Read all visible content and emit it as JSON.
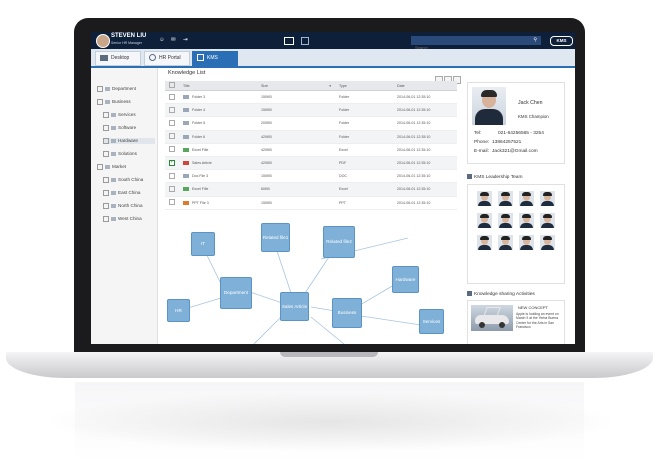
{
  "user": {
    "name": "STEVEN LIU",
    "role": "Senior HR Manager"
  },
  "search": {
    "placeholder": "Search"
  },
  "brand": {
    "label": "KMS"
  },
  "tabs": [
    {
      "label": "Desktop",
      "active": false
    },
    {
      "label": "HR Portal",
      "active": false
    },
    {
      "label": "KMS",
      "active": true
    }
  ],
  "sidebar": {
    "items": [
      {
        "label": "Department",
        "level": 0
      },
      {
        "label": "Business",
        "level": 0
      },
      {
        "label": "Services",
        "level": 1
      },
      {
        "label": "Software",
        "level": 1
      },
      {
        "label": "Hardware",
        "level": 1,
        "selected": true
      },
      {
        "label": "Solutions",
        "level": 1
      },
      {
        "label": "Market",
        "level": 0
      },
      {
        "label": "South China",
        "level": 1
      },
      {
        "label": "East China",
        "level": 1
      },
      {
        "label": "North China",
        "level": 1
      },
      {
        "label": "West China",
        "level": 1
      }
    ]
  },
  "knowledge_list": {
    "title": "Knowledge List",
    "columns": [
      "Title",
      "Size",
      "Type",
      "Date"
    ],
    "rows": [
      {
        "title": "Folder 3",
        "size": "150KB",
        "type": "Folder",
        "date": "2014-06-01 12:35:10",
        "icon": "folder",
        "checked": false
      },
      {
        "title": "Folder 4",
        "size": "150KB",
        "type": "Folder",
        "date": "2014-06-01 12:35:10",
        "icon": "folder",
        "checked": false
      },
      {
        "title": "Folder 5",
        "size": "200KB",
        "type": "Folder",
        "date": "2014-06-01 12:35:10",
        "icon": "folder",
        "checked": false
      },
      {
        "title": "Folder 6",
        "size": "420KB",
        "type": "Folder",
        "date": "2014-06-01 12:35:10",
        "icon": "folder",
        "checked": false
      },
      {
        "title": "Excel Fille",
        "size": "420KB",
        "type": "Excel",
        "date": "2014-06-01 12:35:10",
        "icon": "excel",
        "checked": false
      },
      {
        "title": "Sales Article",
        "size": "420KB",
        "type": "PDF",
        "date": "2014-06-01 12:35:10",
        "icon": "pdf",
        "checked": true
      },
      {
        "title": "Doc File 3",
        "size": "150KB",
        "type": "DOC",
        "date": "2014-06-01 12:35:10",
        "icon": "doc",
        "checked": false
      },
      {
        "title": "Excel Fille",
        "size": "60KB",
        "type": "Excel",
        "date": "2014-06-01 12:35:10",
        "icon": "excel",
        "checked": false
      },
      {
        "title": "PPT File 3",
        "size": "150KB",
        "type": "PPT",
        "date": "2014-06-01 12:35:10",
        "icon": "ppt",
        "checked": false
      }
    ]
  },
  "mindmap": {
    "nodes": {
      "it": "IT",
      "related1": "Related file1",
      "related2": "Related file2",
      "department": "Department",
      "hardware": "Hardware",
      "hr": "HR",
      "sales": "Sales Article",
      "business": "Business",
      "services": "Services"
    }
  },
  "profile": {
    "name": "Jack Chen",
    "role": "KMS Champion",
    "tel_label": "Tel:",
    "tel": "021-64256565 - 3254",
    "phone_label": "Phone:",
    "phone": "13864257521",
    "email_label": "E-mail:",
    "email": "Jack321@Gmail.com"
  },
  "team": {
    "title": "KMS Leadership Team"
  },
  "sharing": {
    "title": "Knowledge sharing Activities",
    "item_title": "NEW CONCEPT",
    "item_text": "Apple is holding an event on March 9 at the Yerba Buena Center for the Arts in San Francisco"
  },
  "colors": {
    "topbar": "#0e1f3a",
    "accent": "#2a6fb5",
    "node": "#7fb0d8"
  }
}
